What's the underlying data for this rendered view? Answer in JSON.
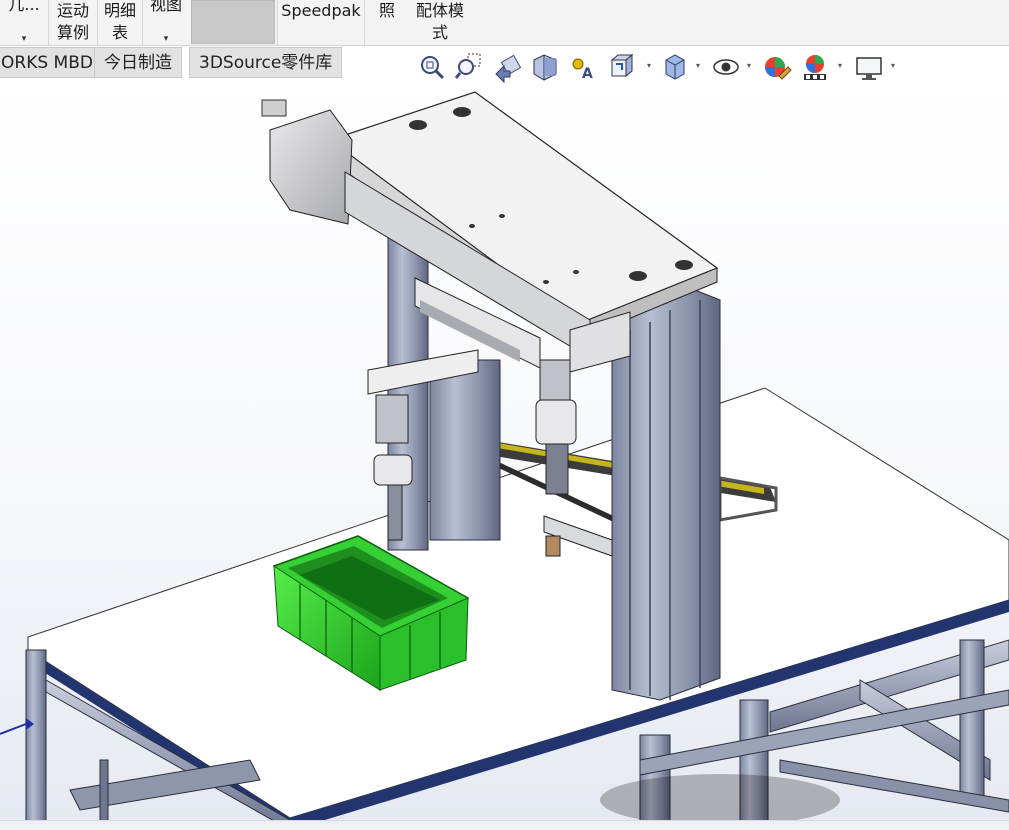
{
  "ribbon": {
    "item1_label": "几...",
    "item2_label_line1": "运动",
    "item2_label_line2": "算例",
    "item3_label_line1": "明细",
    "item3_label_line2": "表",
    "item4_label": "视图",
    "speedpak_label": "Speedpak",
    "item6_label": "照",
    "item7_label_line1": "配体模",
    "item7_label_line2": "式",
    "caret_glyph": "▾"
  },
  "tabs": [
    {
      "label": "ORKS MBD"
    },
    {
      "label": "今日制造"
    },
    {
      "label": "3DSource零件库"
    }
  ],
  "hud": {
    "icons": [
      "zoom-to-fit-icon",
      "zoom-to-area-icon",
      "previous-view-icon",
      "section-view-icon",
      "dynamic-annotation-icon",
      "view-orientation-icon",
      "display-style-icon",
      "hide-show-items-icon",
      "edit-appearance-icon",
      "apply-scene-icon",
      "view-settings-icon"
    ]
  },
  "colors": {
    "ribbon_bg": "#f3f3f3",
    "tab_bg": "#e2e2e2",
    "bin_green": "#2fd42f",
    "frame_steel": "#9aa3b8",
    "table_edge_blue": "#22356f"
  }
}
